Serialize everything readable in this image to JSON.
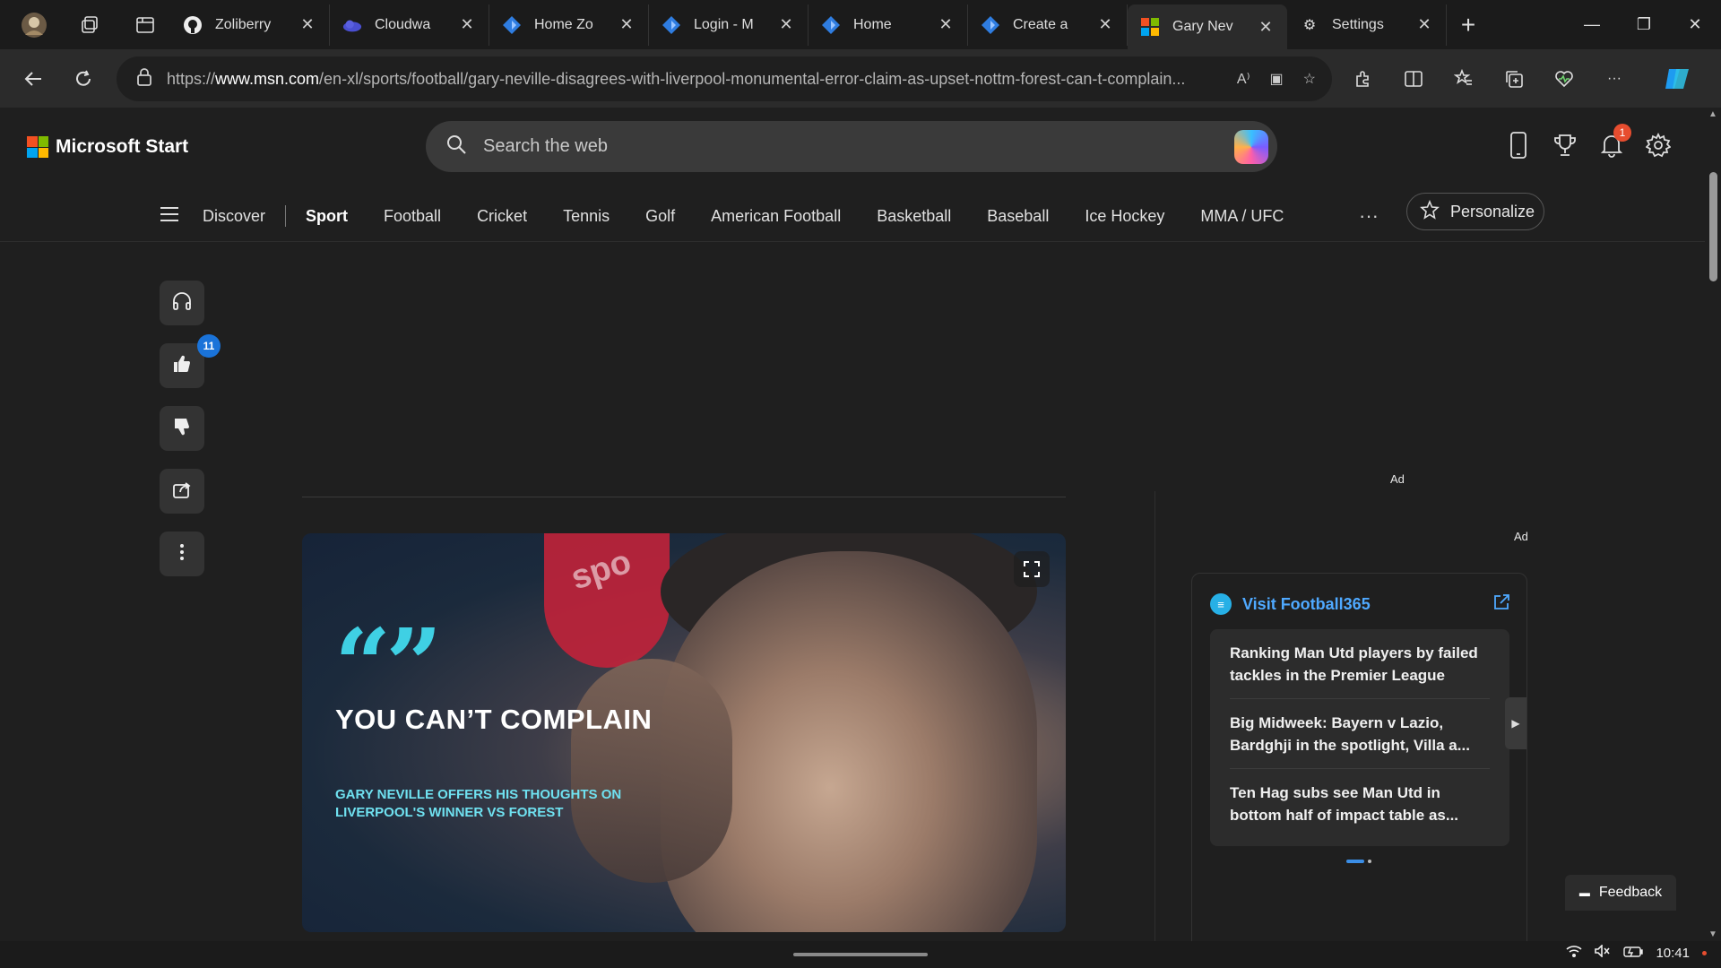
{
  "browser": {
    "tabs": [
      {
        "title": "Zoliberry",
        "favicon": "github-icon"
      },
      {
        "title": "Cloudwa",
        "favicon": "cloud-icon"
      },
      {
        "title": "Home Zo",
        "favicon": "blue-diamond-icon"
      },
      {
        "title": "Login - M",
        "favicon": "blue-diamond-icon"
      },
      {
        "title": "Home",
        "favicon": "blue-diamond-icon"
      },
      {
        "title": "Create a",
        "favicon": "blue-diamond-icon"
      },
      {
        "title": "Gary Nev",
        "favicon": "microsoft-icon",
        "active": true
      },
      {
        "title": "Settings",
        "favicon": "gear-icon"
      }
    ],
    "url_prefix": "https://",
    "url_host": "www.msn.com",
    "url_path": "/en-xl/sports/football/gary-neville-disagrees-with-liverpool-monumental-error-claim-as-upset-nottm-forest-can-t-complain..."
  },
  "header": {
    "brand": "Microsoft Start",
    "search_placeholder": "Search the web",
    "notification_count": "1"
  },
  "nav": {
    "items": [
      "Discover",
      "Sport",
      "Football",
      "Cricket",
      "Tennis",
      "Golf",
      "American Football",
      "Basketball",
      "Baseball",
      "Ice Hockey",
      "MMA / UFC"
    ],
    "current": "Sport",
    "more": "···",
    "personalize": "Personalize"
  },
  "actions": {
    "like_count": "11"
  },
  "ads": {
    "label_top": "Ad",
    "label_right": "Ad"
  },
  "hero": {
    "quote_marks": "“”",
    "headline": "YOU CAN’T COMPLAIN",
    "subline": "GARY NEVILLE OFFERS HIS THOUGHTS ON LIVERPOOL'S WINNER VS FOREST",
    "mic_brand": "spo"
  },
  "football365": {
    "title": "Visit Football365",
    "articles": [
      "Ranking Man Utd players by failed tackles in the Premier League",
      "Big Midweek: Bayern v Lazio, Bardghji in the spotlight, Villa a...",
      "Ten Hag subs see Man Utd in bottom half of impact table as..."
    ]
  },
  "feedback": "Feedback",
  "taskbar": {
    "time": "10:41"
  },
  "colors": {
    "accent_blue": "#4fa9ff",
    "badge_blue": "#1a73d9",
    "badge_red": "#e74d2f",
    "hero_cyan": "#3fd0e4"
  }
}
